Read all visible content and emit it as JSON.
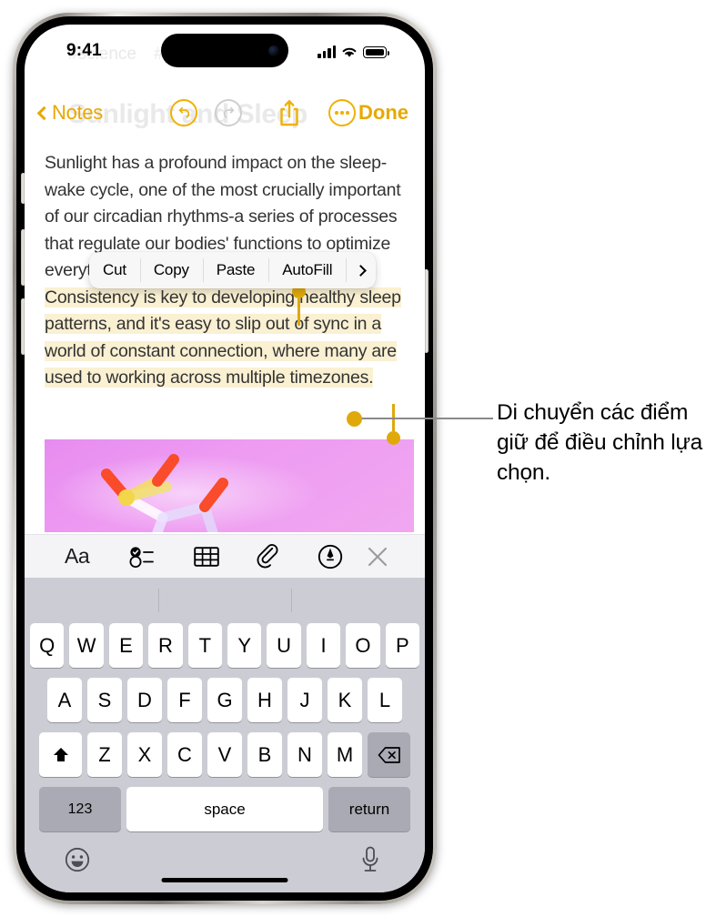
{
  "status_bar": {
    "time": "9:41",
    "signal_icon": "cellular-signal-icon",
    "wifi_icon": "wifi-icon",
    "battery_icon": "battery-full-icon"
  },
  "ghost_title": {
    "tag_one": "#science",
    "tag_two": "#psychology",
    "title": "Sunlight and Sleep"
  },
  "nav_bar": {
    "back_label": "Notes",
    "undo_icon": "undo-icon",
    "redo_icon": "redo-icon",
    "share_icon": "share-icon",
    "more_icon": "more-ellipsis-icon",
    "done_label": "Done"
  },
  "note": {
    "paragraph_before": "Sunlight has a profound impact on the sleep-wake cycle, one of the most crucially important of our circadian rhythms-a series of processes that regulate our bodies' functions to optimize everything from wakefulness to digestion. ",
    "selected_text": "Consistency is key to developing healthy sleep patterns, and it's easy to slip out of sync in a world of constant connection, where many are used to working across multiple timezones.",
    "attachment_name": "molecule-image-attachment"
  },
  "edit_menu": {
    "items": [
      {
        "label": "Cut",
        "name": "edit-menu-cut"
      },
      {
        "label": "Copy",
        "name": "edit-menu-copy"
      },
      {
        "label": "Paste",
        "name": "edit-menu-paste"
      },
      {
        "label": "AutoFill",
        "name": "edit-menu-autofill"
      }
    ],
    "more_icon": "chevron-right-icon"
  },
  "format_toolbar": {
    "format_label": "Aa",
    "checklist_icon": "checklist-icon",
    "table_icon": "table-icon",
    "attach_icon": "paperclip-icon",
    "markup_icon": "markup-pen-icon",
    "close_icon": "close-x-icon"
  },
  "keyboard": {
    "row1": [
      "Q",
      "W",
      "E",
      "R",
      "T",
      "Y",
      "U",
      "I",
      "O",
      "P"
    ],
    "row2": [
      "A",
      "S",
      "D",
      "F",
      "G",
      "H",
      "J",
      "K",
      "L"
    ],
    "row3": [
      "Z",
      "X",
      "C",
      "V",
      "B",
      "N",
      "M"
    ],
    "shift_icon": "shift-arrow-icon",
    "backspace_icon": "backspace-icon",
    "numeric_label": "123",
    "space_label": "space",
    "return_label": "return",
    "emoji_icon": "emoji-smiley-icon",
    "mic_icon": "microphone-icon"
  },
  "callout": {
    "text": "Di chuyển các điểm giữ để điều chỉnh lựa chọn."
  },
  "colors": {
    "accent": "#E8A800",
    "selection_highlight": "#FAF0D2",
    "handle": "#DFA90B",
    "keyboard_background": "#ccccd4",
    "image_background": "#ee9bf2"
  }
}
